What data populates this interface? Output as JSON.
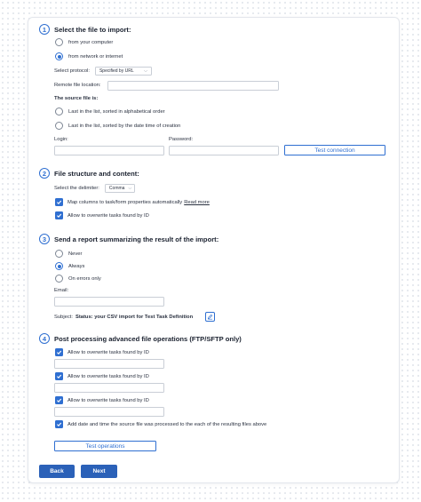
{
  "sections": [
    {
      "num": "1",
      "title": "Select the file to import:",
      "options": [
        "from your computer",
        "from network or internet"
      ],
      "protocol_label": "Select protocol:",
      "protocol_value": "Specified by URL",
      "remote_label": "Remote file location:",
      "source_label": "The source file is:",
      "source_options": [
        "Last in the list, sorted in alphabetical order",
        "Last in the list, sorted by the date time of creation"
      ],
      "login_label": "Login:",
      "password_label": "Password:",
      "test_connection": "Test connection"
    },
    {
      "num": "2",
      "title": "File structure and content:",
      "delimiter_label": "Select the delimiter:",
      "delimiter_value": "Comma",
      "map_label": "Map columns to task/form properties automatically",
      "map_link": "Read more",
      "overwrite_label": "Allow to overwrite tasks found by ID"
    },
    {
      "num": "3",
      "title": "Send a report summarizing the result of the import:",
      "options": [
        "Never",
        "Always",
        "On errors only"
      ],
      "email_label": "Email:",
      "subject_prefix": "Subject:",
      "subject_value": "Status: your CSV import for Test Task Definition"
    },
    {
      "num": "4",
      "title": "Post processing advanced file operations (FTP/SFTP only)",
      "overwrite_labels": [
        "Allow to overwrite tasks found by ID",
        "Allow to overwrite tasks found by ID",
        "Allow to overwrite tasks found by ID"
      ],
      "add_date_label": "Add date and time the source file was processed to the each of the resulting files above",
      "test_operations": "Test operations"
    }
  ],
  "footer": {
    "back": "Back",
    "next": "Next"
  },
  "colors": {
    "accent": "#2f6fd1",
    "primary_button": "#2b61b8"
  }
}
